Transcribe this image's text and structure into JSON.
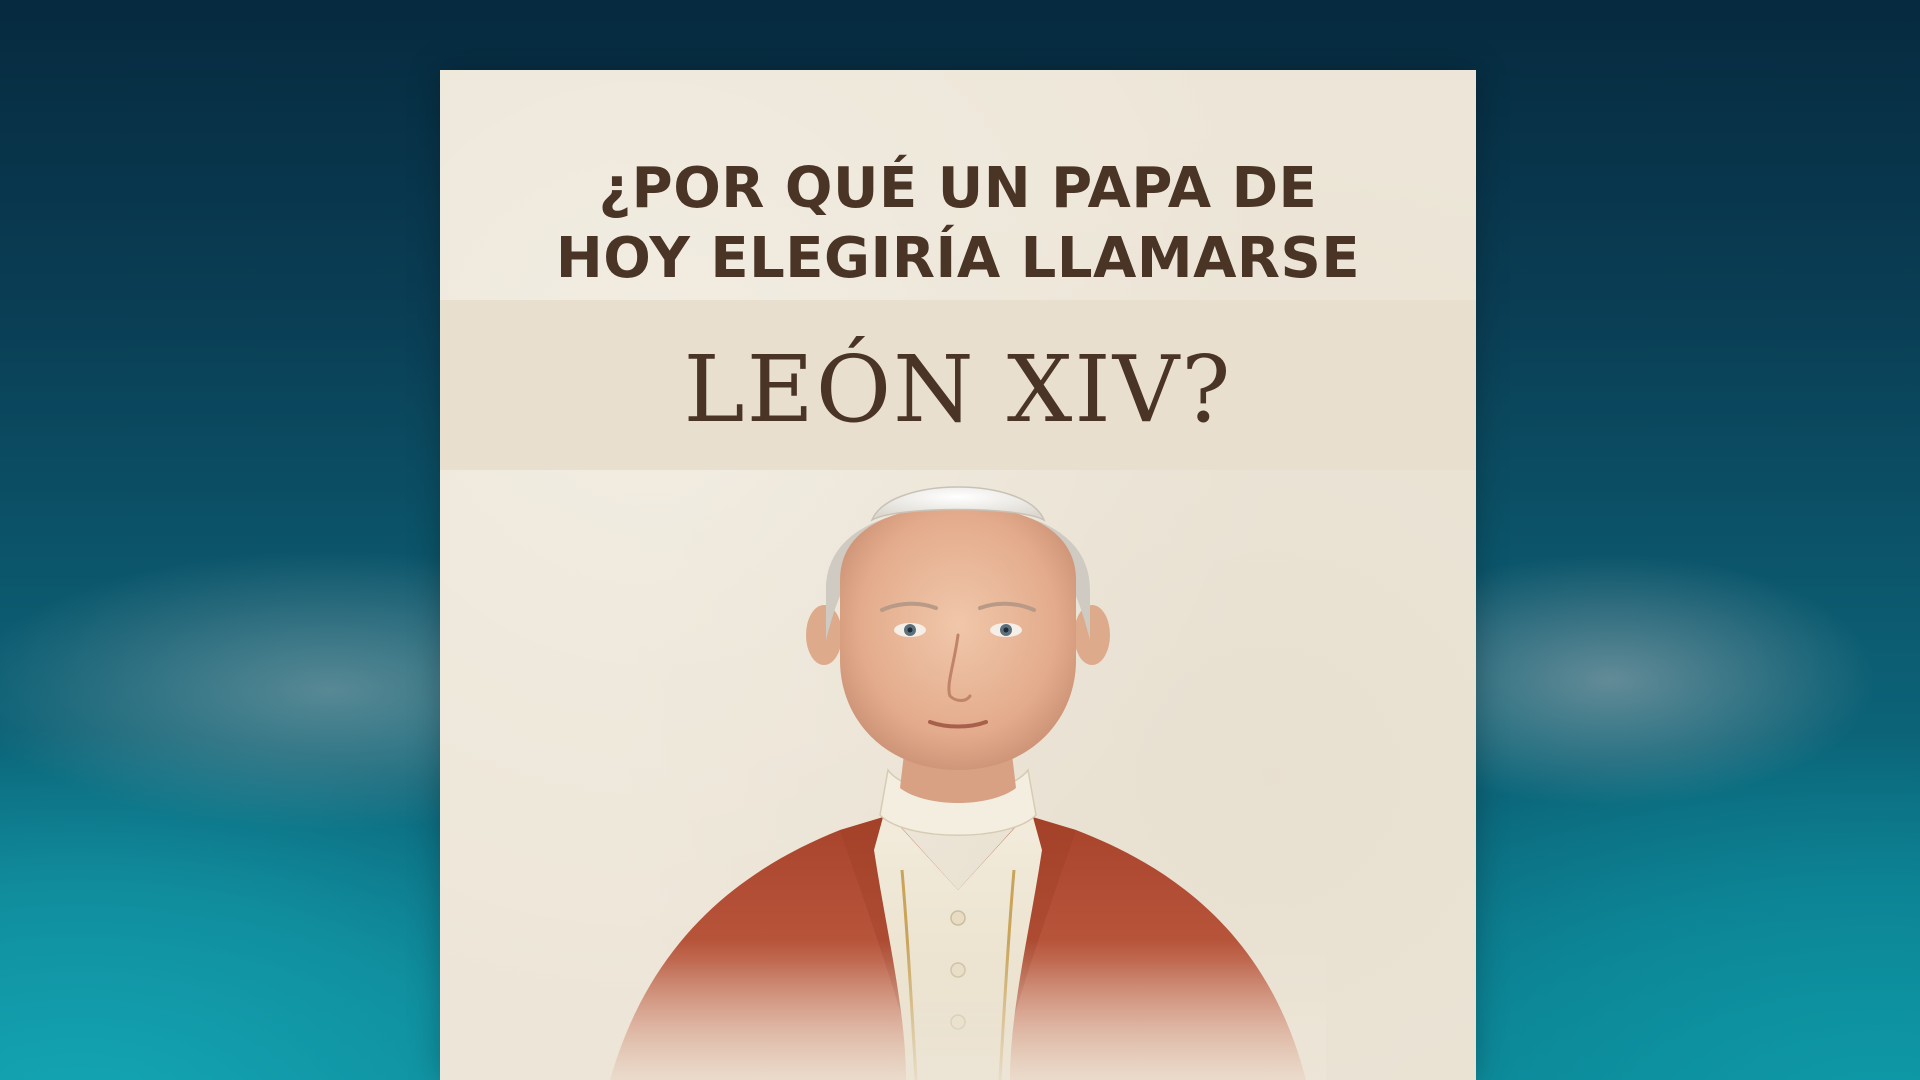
{
  "poster": {
    "question_line_1": "¿POR QUÉ UN PAPA DE",
    "question_line_2": "HOY ELEGIRÍA LLAMARSE",
    "name": "LEÓN XIV?"
  },
  "colors": {
    "background_top": "#062a3f",
    "background_bottom_glow": "#14a6b4",
    "poster_paper": "#ede6d8",
    "title_text": "#4a3426",
    "mozzetta_red": "#b4533a",
    "cassock_cream": "#f1ead9"
  },
  "icons": {
    "portrait": "pope-portrait-illustration"
  }
}
